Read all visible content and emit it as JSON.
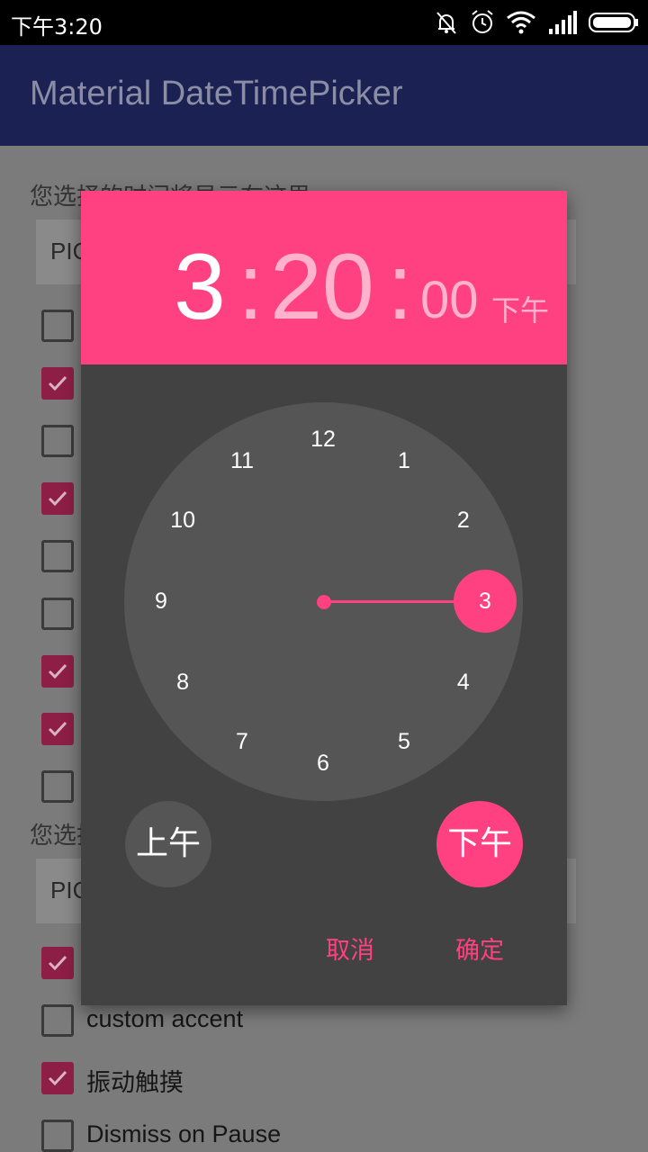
{
  "status_bar": {
    "time": "下午3:20",
    "icons": [
      "bell-off-icon",
      "alarm-icon",
      "wifi-icon",
      "signal-icon",
      "battery-icon"
    ]
  },
  "app_bar": {
    "title": "Material DateTimePicker"
  },
  "background": {
    "label_top": "您选择的时间将显示在这里",
    "field_top": "PIC",
    "label_bottom": "您选择",
    "field_bottom": "PIC",
    "checkboxes_top": [
      false,
      true,
      false,
      true,
      false,
      false,
      true,
      true,
      false
    ],
    "checkboxes_bottom": [
      {
        "checked": true,
        "label": ""
      },
      {
        "checked": false,
        "label": "custom accent"
      },
      {
        "checked": true,
        "label": "振动触摸"
      },
      {
        "checked": false,
        "label": "Dismiss on Pause"
      }
    ]
  },
  "dialog": {
    "header": {
      "hour": "3",
      "sep1": ":",
      "minute": "20",
      "sep2": ":",
      "second": "00",
      "ampm": "下午"
    },
    "clock": {
      "numbers": [
        "12",
        "1",
        "2",
        "3",
        "4",
        "5",
        "6",
        "7",
        "8",
        "9",
        "10",
        "11"
      ],
      "selected": "3"
    },
    "am_label": "上午",
    "pm_label": "下午",
    "cancel_label": "取消",
    "ok_label": "确定",
    "accent_color": "#ff4081"
  }
}
